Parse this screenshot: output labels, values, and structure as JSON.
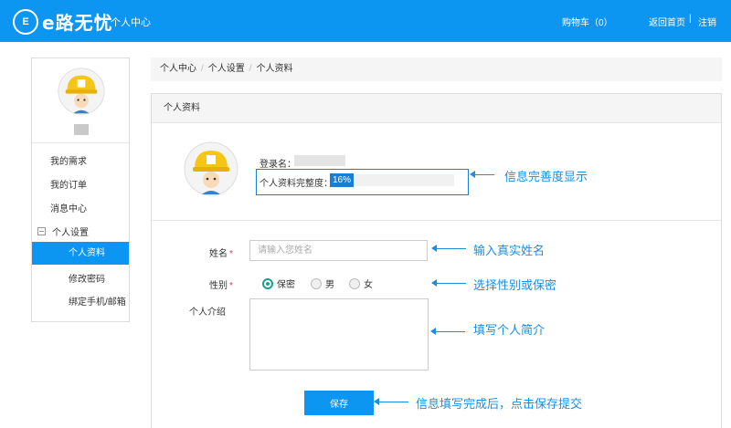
{
  "header": {
    "logo_mark": "E",
    "logo_text": "e路无忧",
    "title": "个人中心",
    "cart": "购物车（0）",
    "home": "返回首页",
    "separator": "|",
    "logout": "注销"
  },
  "sidebar": {
    "items": [
      {
        "label": "我的需求"
      },
      {
        "label": "我的订单"
      },
      {
        "label": "消息中心"
      }
    ],
    "group": {
      "label": "个人设置"
    },
    "sub_items": [
      {
        "label": "个人资料",
        "active": true
      },
      {
        "label": "修改密码"
      },
      {
        "label": "绑定手机/邮箱"
      }
    ]
  },
  "breadcrumb": {
    "items": [
      "个人中心",
      "个人设置",
      "个人资料"
    ],
    "separator": "/"
  },
  "panel": {
    "title": "个人资料",
    "login_label": "登录名：",
    "completeness_label": "个人资料完整度：",
    "completeness_value": "16%",
    "completeness_fraction": 0.16
  },
  "form": {
    "name_label": "姓名",
    "required_mark": "*",
    "name_placeholder": "请输入您姓名",
    "gender_label": "性别",
    "gender_options": [
      "保密",
      "男",
      "女"
    ],
    "gender_selected": "保密",
    "intro_label": "个人介绍",
    "save_label": "保存"
  },
  "annotations": {
    "completeness": "信息完善度显示",
    "name": "输入真实姓名",
    "gender": "选择性别或保密",
    "intro": "填写个人简介",
    "save": "信息填写完成后，点击保存提交"
  },
  "colors": {
    "primary": "#0d95f2",
    "annotation": "#1a8fe0",
    "radio_checked": "#1aa08c"
  }
}
